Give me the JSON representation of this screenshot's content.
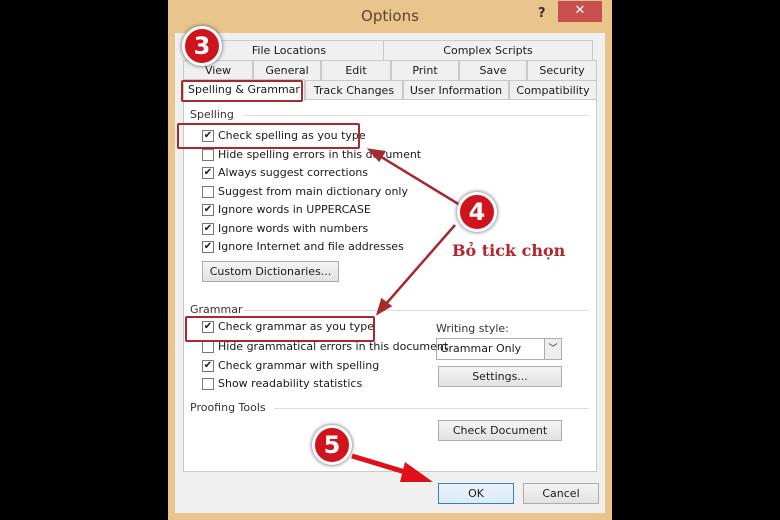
{
  "window": {
    "title": "Options",
    "help": "?",
    "close": "✕"
  },
  "tabs": {
    "row1": [
      "File Locations",
      "Complex Scripts"
    ],
    "row2": [
      "View",
      "General",
      "Edit",
      "Print",
      "Save",
      "Security"
    ],
    "row3": [
      "Spelling & Grammar",
      "Track Changes",
      "User Information",
      "Compatibility"
    ],
    "selected": "Spelling & Grammar"
  },
  "spelling": {
    "label": "Spelling",
    "items": [
      {
        "label": "Check spelling as you type",
        "checked": true
      },
      {
        "label": "Hide spelling errors in this document",
        "checked": false
      },
      {
        "label": "Always suggest corrections",
        "checked": true
      },
      {
        "label": "Suggest from main dictionary only",
        "checked": false
      },
      {
        "label": "Ignore words in UPPERCASE",
        "checked": true
      },
      {
        "label": "Ignore words with numbers",
        "checked": true
      },
      {
        "label": "Ignore Internet and file addresses",
        "checked": true
      }
    ],
    "custom_dictionaries": "Custom Dictionaries..."
  },
  "grammar": {
    "label": "Grammar",
    "items": [
      {
        "label": "Check grammar as you type",
        "checked": true
      },
      {
        "label": "Hide grammatical errors in this document",
        "checked": false
      },
      {
        "label": "Check grammar with spelling",
        "checked": true
      },
      {
        "label": "Show readability statistics",
        "checked": false
      }
    ],
    "writing_style_label": "Writing style:",
    "writing_style_value": "Grammar Only",
    "settings": "Settings..."
  },
  "proofing": {
    "label": "Proofing Tools",
    "check_document": "Check Document"
  },
  "footer": {
    "ok": "OK",
    "cancel": "Cancel"
  },
  "annotations": {
    "step3": "3",
    "step4": "4",
    "step5": "5",
    "note": "Bỏ tick chọn",
    "color": "#d0141d"
  }
}
